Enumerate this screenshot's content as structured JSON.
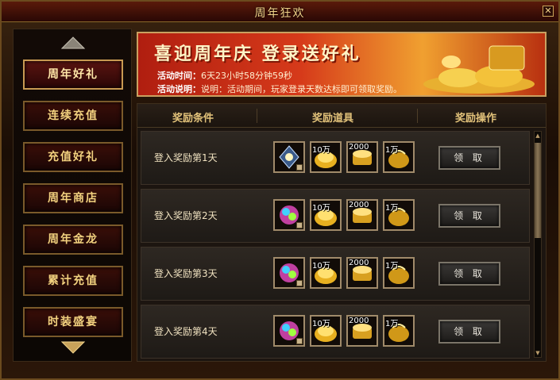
{
  "window": {
    "title": "周年狂欢",
    "close": "✕"
  },
  "sidebar": {
    "items": [
      {
        "label": "周年好礼",
        "active": true
      },
      {
        "label": "连续充值",
        "active": false
      },
      {
        "label": "充值好礼",
        "active": false
      },
      {
        "label": "周年商店",
        "active": false
      },
      {
        "label": "周年金龙",
        "active": false
      },
      {
        "label": "累计充值",
        "active": false
      },
      {
        "label": "时装盛宴",
        "active": false
      }
    ]
  },
  "banner": {
    "headline": "喜迎周年庆 登录送好礼",
    "time_label": "活动时间：",
    "time_value": "6天23小时58分钟59秒",
    "desc_label": "活动说明：",
    "desc_value": "说明：活动期间，玩家登录天数达标即可领取奖励。"
  },
  "table": {
    "headers": [
      "奖励条件",
      "奖励道具",
      "奖励操作"
    ],
    "rows": [
      {
        "condition": "登入奖励第1天",
        "items": [
          "",
          "10万",
          "2000",
          "1万"
        ],
        "button": "领 取"
      },
      {
        "condition": "登入奖励第2天",
        "items": [
          "",
          "10万",
          "2000",
          "1万"
        ],
        "button": "领 取"
      },
      {
        "condition": "登入奖励第3天",
        "items": [
          "",
          "10万",
          "2000",
          "1万"
        ],
        "button": "领 取"
      },
      {
        "condition": "登入奖励第4天",
        "items": [
          "",
          "10万",
          "2000",
          "1万"
        ],
        "button": "领 取"
      }
    ]
  },
  "scrollbar": {
    "up": "▲",
    "down": "▼"
  }
}
